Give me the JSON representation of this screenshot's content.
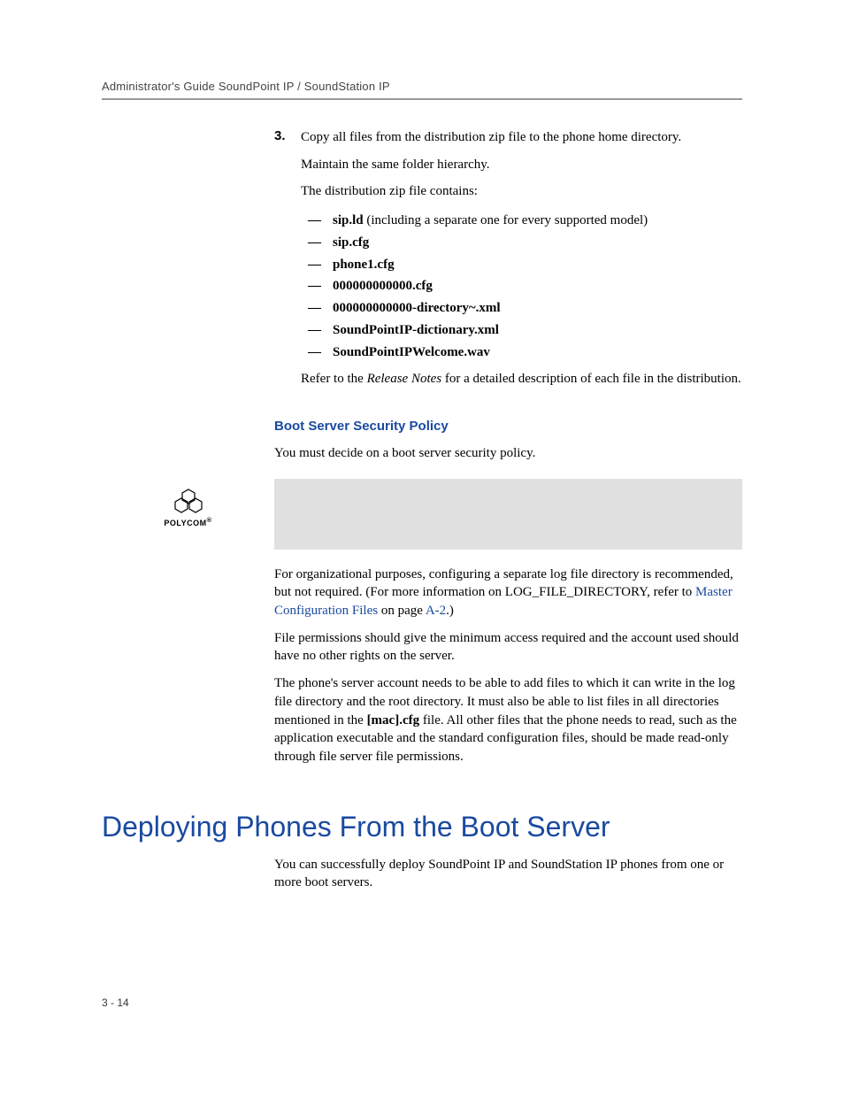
{
  "header": "Administrator's Guide SoundPoint IP / SoundStation IP",
  "step": {
    "number": "3.",
    "text": "Copy all files from the distribution zip file to the phone home directory.",
    "sub1": "Maintain the same folder hierarchy.",
    "sub2": "The distribution zip file contains:"
  },
  "files": {
    "f1a": "sip.ld",
    "f1b": " (including a separate one for every supported model)",
    "f2": "sip.cfg",
    "f3": "phone1.cfg",
    "f4": "000000000000.cfg",
    "f5": "000000000000-directory~.xml",
    "f6": "SoundPointIP-dictionary.xml",
    "f7": "SoundPointIPWelcome.wav"
  },
  "refer": {
    "pre": "Refer to the ",
    "italic": "Release Notes",
    "post": " for a detailed description of each file in the distribution."
  },
  "subheading": "Boot Server Security Policy",
  "policy_intro": "You must decide on a boot server security policy.",
  "logo_label": "POLYCOM",
  "org": {
    "pre": "For organizational purposes, configuring a separate log file directory is recommended, but not required. (For more information on LOG_FILE_DIRECTORY, refer to ",
    "link": "Master Configuration Files",
    "mid": " on page ",
    "pageref": "A-2",
    "post": ".)"
  },
  "perm": "File permissions should give the minimum access required and the account used should have no other rights on the server.",
  "account": {
    "pre": "The phone's server account needs to be able to add files to which it can write in the log file directory and the root directory. It must also be able to list files in all directories mentioned in the ",
    "bold": "[mac].cfg",
    "post": " file. All other files that the phone needs to read, such as the application executable and the standard configuration files, should be made read-only through file server file permissions."
  },
  "major_heading": "Deploying Phones From the Boot Server",
  "deploy_text": "You can successfully deploy SoundPoint IP and SoundStation IP phones from one or more boot servers.",
  "page_number": "3 - 14"
}
